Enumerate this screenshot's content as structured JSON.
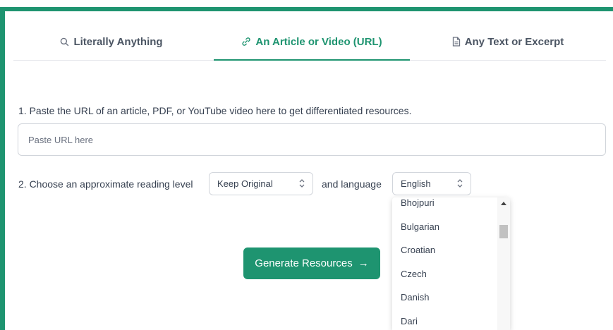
{
  "tabs": [
    {
      "label": "Literally Anything",
      "icon": "search-icon"
    },
    {
      "label": "An Article or Video (URL)",
      "icon": "link-icon",
      "active": true
    },
    {
      "label": "Any Text or Excerpt",
      "icon": "document-icon"
    }
  ],
  "step1": {
    "label": "1. Paste the URL of an article, PDF, or YouTube video here to get differentiated resources.",
    "placeholder": "Paste URL here",
    "value": ""
  },
  "step2": {
    "label": "2. Choose an approximate reading level",
    "reading_level": "Keep Original",
    "and_language": "and language",
    "language": "English"
  },
  "language_options": [
    "Bhojpuri",
    "Bulgarian",
    "Croatian",
    "Czech",
    "Danish",
    "Dari"
  ],
  "generate_label": "Generate Resources",
  "colors": {
    "accent": "#1e9470",
    "border": "#d1d5db",
    "text": "#374151"
  }
}
